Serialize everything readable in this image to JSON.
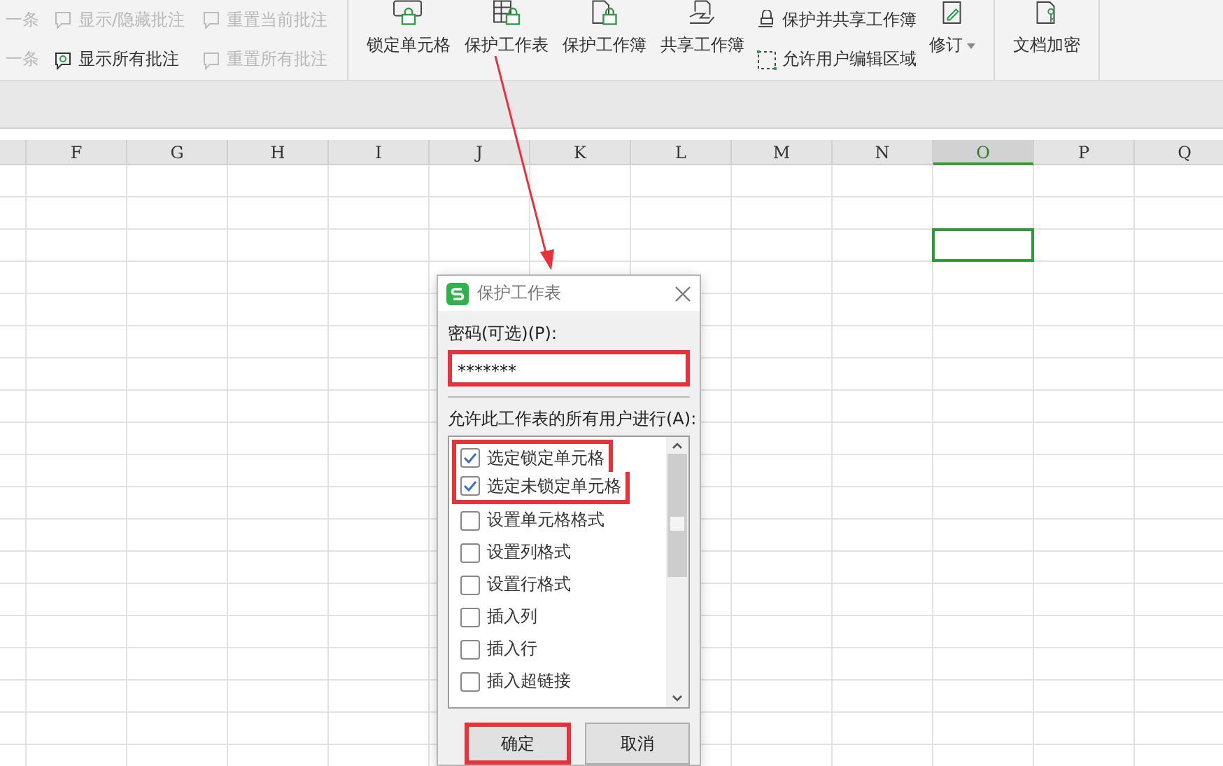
{
  "ribbon": {
    "left_items": [
      {
        "label": "一条",
        "disabled": true
      },
      {
        "label": "一条",
        "disabled": true
      }
    ],
    "comment_buttons": [
      {
        "label": "显示/隐藏批注",
        "disabled": true
      },
      {
        "label": "显示所有批注",
        "disabled": false
      },
      {
        "label": "重置当前批注",
        "disabled": true
      },
      {
        "label": "重置所有批注",
        "disabled": true
      }
    ],
    "protect_buttons": [
      {
        "label": "锁定单元格"
      },
      {
        "label": "保护工作表"
      },
      {
        "label": "保护工作簿"
      },
      {
        "label": "共享工作簿"
      }
    ],
    "small_buttons": [
      {
        "label": "保护并共享工作簿"
      },
      {
        "label": "允许用户编辑区域"
      }
    ],
    "revise": {
      "label": "修订"
    },
    "encrypt": {
      "label": "文档加密"
    }
  },
  "columns": [
    {
      "label": "F",
      "selected": false
    },
    {
      "label": "G",
      "selected": false
    },
    {
      "label": "H",
      "selected": false
    },
    {
      "label": "I",
      "selected": false
    },
    {
      "label": "J",
      "selected": false
    },
    {
      "label": "K",
      "selected": false
    },
    {
      "label": "L",
      "selected": false
    },
    {
      "label": "M",
      "selected": false
    },
    {
      "label": "N",
      "selected": false
    },
    {
      "label": "O",
      "selected": true
    },
    {
      "label": "P",
      "selected": false
    },
    {
      "label": "Q",
      "selected": false
    }
  ],
  "dialog": {
    "title": "保护工作表",
    "password_label": "密码(可选)(P):",
    "password": "*******",
    "password_highlighted": true,
    "permissions_label": "允许此工作表的所有用户进行(A):",
    "options": [
      {
        "label": "选定锁定单元格",
        "checked": true,
        "highlighted": true
      },
      {
        "label": "选定未锁定单元格",
        "checked": true,
        "highlighted": true
      },
      {
        "label": "设置单元格格式",
        "checked": false,
        "highlighted": false
      },
      {
        "label": "设置列格式",
        "checked": false,
        "highlighted": false
      },
      {
        "label": "设置行格式",
        "checked": false,
        "highlighted": false
      },
      {
        "label": "插入列",
        "checked": false,
        "highlighted": false
      },
      {
        "label": "插入行",
        "checked": false,
        "highlighted": false
      },
      {
        "label": "插入超链接",
        "checked": false,
        "highlighted": false
      }
    ],
    "buttons": [
      {
        "label": "确定",
        "highlighted": true
      },
      {
        "label": "取消",
        "highlighted": false
      }
    ]
  }
}
